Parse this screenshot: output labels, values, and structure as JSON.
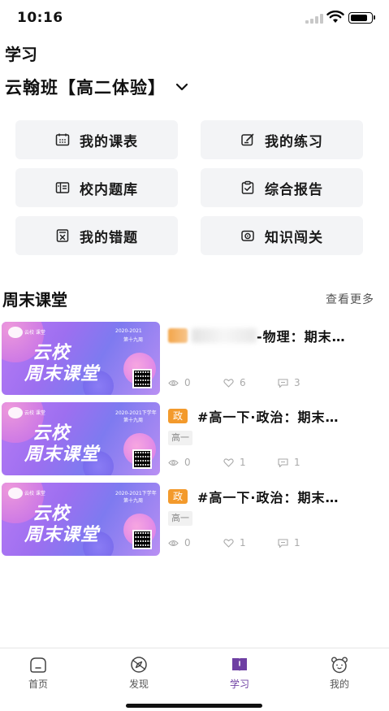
{
  "status_bar": {
    "time": "10:16"
  },
  "header": {
    "page_title": "学习",
    "class_name": "云翰班【高二体验】"
  },
  "grid": [
    {
      "label": "我的课表",
      "icon": "calendar-icon"
    },
    {
      "label": "我的练习",
      "icon": "edit-note-icon"
    },
    {
      "label": "校内题库",
      "icon": "question-bank-icon"
    },
    {
      "label": "综合报告",
      "icon": "clipboard-check-icon"
    },
    {
      "label": "我的错题",
      "icon": "wrong-answer-icon"
    },
    {
      "label": "知识闯关",
      "icon": "camera-challenge-icon"
    }
  ],
  "section": {
    "title": "周末课堂",
    "see_more": "查看更多"
  },
  "courses": [
    {
      "tag": "",
      "title": "-物理：期末…",
      "grade": "",
      "views": "0",
      "likes": "6",
      "comments": "3",
      "banner": {
        "logo_text": "云校 课堂",
        "date": "2020-2021",
        "week": "第十九周",
        "title1": "云校",
        "title2": "周末课堂"
      }
    },
    {
      "tag": "政",
      "title": "#高一下·政治：期末…",
      "grade": "高一",
      "views": "0",
      "likes": "1",
      "comments": "1",
      "banner": {
        "logo_text": "云校 课堂",
        "date": "2020-2021下学年",
        "week": "第十九周",
        "title1": "云校",
        "title2": "周末课堂"
      }
    },
    {
      "tag": "政",
      "title": "#高一下·政治：期末…",
      "grade": "高一",
      "views": "0",
      "likes": "1",
      "comments": "1",
      "banner": {
        "logo_text": "云校 课堂",
        "date": "2020-2021下学年",
        "week": "第十九周",
        "title1": "云校",
        "title2": "周末课堂"
      }
    }
  ],
  "tabbar": [
    {
      "label": "首页",
      "icon": "home-icon"
    },
    {
      "label": "发现",
      "icon": "compass-icon"
    },
    {
      "label": "学习",
      "icon": "book-icon",
      "active": true
    },
    {
      "label": "我的",
      "icon": "profile-bear-icon"
    }
  ],
  "colors": {
    "accent": "#6e3fa3",
    "tag": "#f39a2c",
    "tile_bg": "#f3f4f6"
  }
}
